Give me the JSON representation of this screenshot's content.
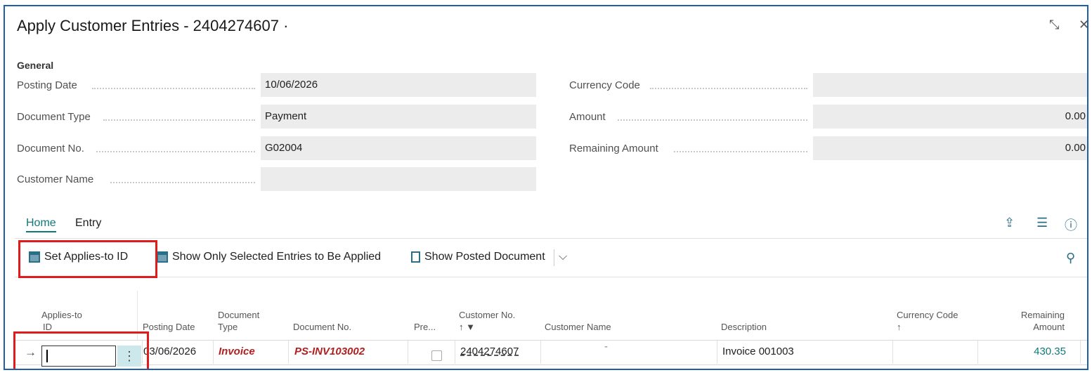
{
  "window": {
    "title": "Apply Customer Entries - 2404274607 ·",
    "collapse_icon": "collapse-icon",
    "close_icon": "close-icon"
  },
  "general": {
    "section_label": "General",
    "fields_left": [
      {
        "label": "Posting Date",
        "value": "10/06/2026"
      },
      {
        "label": "Document Type",
        "value": "Payment"
      },
      {
        "label": "Document No.",
        "value": "G02004"
      },
      {
        "label": "Customer Name",
        "value": ""
      }
    ],
    "fields_right": [
      {
        "label": "Currency Code",
        "value": ""
      },
      {
        "label": "Amount",
        "value": "0.00"
      },
      {
        "label": "Remaining Amount",
        "value": "0.00"
      }
    ]
  },
  "tabs": [
    {
      "label": "Home",
      "active": true
    },
    {
      "label": "Entry",
      "active": false
    }
  ],
  "header_icons": [
    "share-icon",
    "list-icon",
    "info-icon"
  ],
  "actions": {
    "set_applies_to_id": "Set Applies-to ID",
    "show_only_selected": "Show Only Selected Entries to Be Applied",
    "show_posted_document": "Show Posted Document",
    "more_chevron": "⌵",
    "pin_icon": "pin-icon"
  },
  "grid": {
    "columns": {
      "applies_to_id": [
        "Applies-to",
        "ID"
      ],
      "posting_date": "Posting Date",
      "document_type": [
        "Document",
        "Type"
      ],
      "document_no": "Document No.",
      "pre": "Pre...",
      "customer_no": "Customer No.",
      "customer_no_sort": "↑ ▼",
      "customer_name": "Customer Name",
      "description": "Description",
      "currency_code": "Currency Code",
      "currency_sort": "↑",
      "remaining_amount": [
        "Remaining",
        "Amount"
      ]
    },
    "row": {
      "applies_to_id": "",
      "posting_date": "03/06/2026",
      "document_type": "Invoice",
      "document_no": "PS-INV103002",
      "pre": false,
      "customer_no": "2404274607",
      "customer_name": "-",
      "description": "Invoice 001003",
      "currency_code": "",
      "remaining_amount": "430.35"
    }
  },
  "colors": {
    "accent": "#0e7a7a",
    "link_red": "#b31e1e",
    "highlight_red": "#e01b1b",
    "frame_blue": "#1f5fa8"
  }
}
